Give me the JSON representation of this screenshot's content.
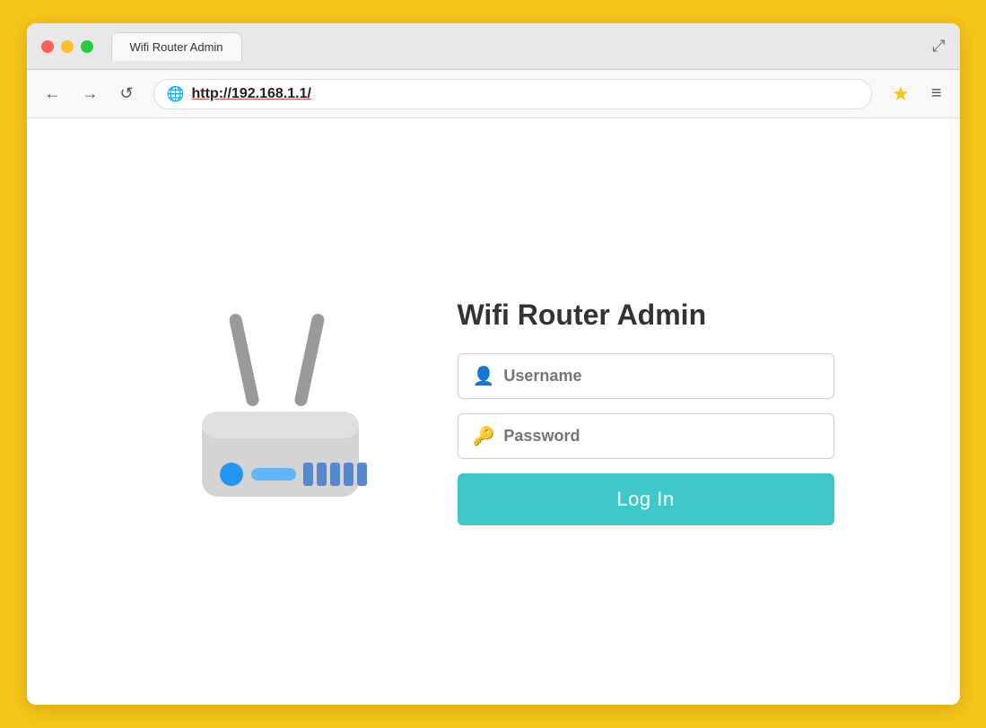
{
  "browser": {
    "url": "http://192.168.1.1/",
    "tab_label": "Wifi Router Admin",
    "traffic_lights": [
      "red",
      "yellow",
      "green"
    ],
    "star_icon": "★",
    "menu_icon": "≡",
    "back_icon": "←",
    "forward_icon": "→",
    "reload_icon": "↺",
    "expand_icon": "⤢"
  },
  "page": {
    "title": "Wifi Router Admin",
    "username_placeholder": "Username",
    "password_placeholder": "Password",
    "login_button": "Log In",
    "username_icon": "👤",
    "password_icon": "🔑"
  },
  "colors": {
    "border_yellow": "#F5C518",
    "login_btn": "#3EC8C8",
    "router_body": "#d4d4d4",
    "router_antenna": "#9a9a9a",
    "router_light_blue": "#2196F3",
    "router_bar": "#64B5F6"
  }
}
